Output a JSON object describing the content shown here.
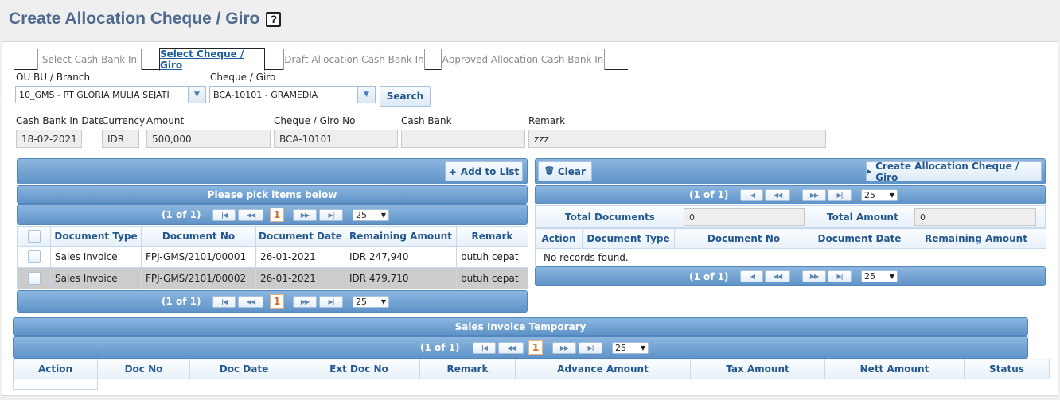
{
  "page": {
    "title": "Create Allocation Cheque / Giro",
    "help_glyph": "?"
  },
  "tabs": [
    {
      "label": "Select Cash Bank In"
    },
    {
      "label": "Select Cheque / Giro"
    },
    {
      "label": "Draft Allocation Cash Bank In"
    },
    {
      "label": "Approved Allocation Cash Bank In"
    }
  ],
  "filters": {
    "ou_label": "OU BU / Branch",
    "ou_value": "10_GMS - PT GLORIA MULIA SEJATI",
    "cheque_label": "Cheque / Giro",
    "cheque_value": "BCA-10101 - GRAMEDIA",
    "search_label": "Search"
  },
  "details": {
    "date_label": "Cash Bank In Date",
    "date_value": "18-02-2021",
    "currency_label": "Currency",
    "currency_value": "IDR",
    "amount_label": "Amount",
    "amount_value": "500,000",
    "cheque_no_label": "Cheque / Giro No",
    "cheque_no_value": "BCA-10101",
    "cash_bank_label": "Cash Bank",
    "cash_bank_value": "",
    "remark_label": "Remark",
    "remark_value": "zzz"
  },
  "left_panel": {
    "add_label": "Add to List",
    "title": "Please pick items below",
    "pager": {
      "info": "(1 of 1)",
      "page": "1",
      "rows": "25"
    },
    "columns": [
      "Document Type",
      "Document No",
      "Document Date",
      "Remaining Amount",
      "Remark"
    ],
    "rows": [
      {
        "type": "Sales Invoice",
        "no": "FPJ-GMS/2101/00001",
        "date": "26-01-2021",
        "remaining": "IDR 247,940",
        "remark": "butuh cepat"
      },
      {
        "type": "Sales Invoice",
        "no": "FPJ-GMS/2101/00002",
        "date": "26-01-2021",
        "remaining": "IDR 479,710",
        "remark": "butuh cepat"
      }
    ]
  },
  "right_panel": {
    "clear_label": "Clear",
    "create_label": "Create Allocation Cheque / Giro",
    "pager": {
      "info": "(1 of 1)",
      "rows": "25"
    },
    "total_docs_label": "Total Documents",
    "total_docs_value": "0",
    "total_amount_label": "Total Amount",
    "total_amount_value": "0",
    "columns": [
      "Action",
      "Document Type",
      "Document No",
      "Document Date",
      "Remaining Amount"
    ],
    "empty_text": "No records found."
  },
  "bottom_panel": {
    "title": "Sales Invoice Temporary",
    "pager": {
      "info": "(1 of 1)",
      "page": "1",
      "rows": "25"
    },
    "columns": [
      "Action",
      "Doc No",
      "Doc Date",
      "Ext Doc No",
      "Remark",
      "Advance Amount",
      "Tax Amount",
      "Nett Amount",
      "Status"
    ]
  },
  "colors": {
    "accent": "#5f93c8",
    "title": "#4e6a8e",
    "header_text": "#24578e",
    "selected_row": "#cccccc"
  }
}
